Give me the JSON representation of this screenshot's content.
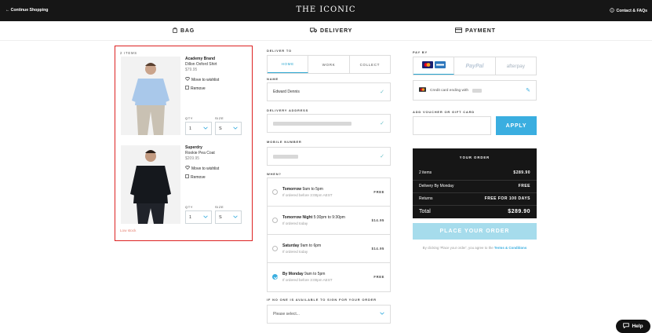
{
  "header": {
    "continue_label": "← Continue Shopping",
    "logo": "THE ICONIC",
    "contact_label": "Contact & FAQs"
  },
  "steps": [
    {
      "label": "BAG",
      "icon": "bag-icon"
    },
    {
      "label": "DELIVERY",
      "icon": "truck-icon"
    },
    {
      "label": "PAYMENT",
      "icon": "card-icon"
    }
  ],
  "bag": {
    "count_label": "2 ITEMS",
    "items": [
      {
        "brand": "Academy Brand",
        "name": "Dillon Oxford Shirt",
        "price": "$79.95",
        "wishlist": "Move to wishlist",
        "remove": "Remove",
        "qty_label": "QTY",
        "size_label": "SIZE",
        "qty": "1",
        "size": "S",
        "colors": {
          "garment": "#a9c8ea",
          "pants": "#c9c1b3"
        }
      },
      {
        "brand": "Superdry",
        "name": "Rookie Pea Coat",
        "price": "$209.95",
        "wishlist": "Move to wishlist",
        "remove": "Remove",
        "qty_label": "QTY",
        "size_label": "SIZE",
        "qty": "1",
        "size": "S",
        "colors": {
          "garment": "#15181d",
          "pants": "#20232a"
        }
      }
    ],
    "low_stock": "Low stock"
  },
  "delivery": {
    "deliver_to_label": "DELIVER TO",
    "tabs": [
      {
        "label": "HOME",
        "active": true
      },
      {
        "label": "WORK",
        "active": false
      },
      {
        "label": "COLLECT",
        "active": false
      }
    ],
    "name_label": "NAME",
    "name_value": "Edward Dennis",
    "address_label": "DELIVERY ADDRESS",
    "mobile_label": "MOBILE NUMBER",
    "when_label": "WHEN?",
    "slots": [
      {
        "day": "Tomorrow",
        "time": " 9am to 5pm",
        "note": "If ordered before 3:00pm AEST",
        "fee": "FREE",
        "selected": false
      },
      {
        "day": "Tomorrow Night",
        "time": " 5:30pm to 9:30pm",
        "note": "If ordered today",
        "fee": "$14.95",
        "selected": false
      },
      {
        "day": "Saturday",
        "time": " 9am to 6pm",
        "note": "If ordered today",
        "fee": "$14.95",
        "selected": false
      },
      {
        "day": "By Monday",
        "time": " 9am to 5pm",
        "note": "If ordered before 3:00pm AEST",
        "fee": "FREE",
        "selected": true
      }
    ],
    "sign_label": "IF NO ONE IS AVAILABLE TO SIGN FOR YOUR ORDER",
    "sign_placeholder": "Please select..."
  },
  "payment": {
    "pay_by_label": "PAY BY",
    "paypal": "PayPal",
    "afterpay": "afterpay",
    "card_text": "Credit card ending with",
    "voucher_label": "ADD VOUCHER OR GIFT CARD",
    "apply_label": "APPLY",
    "order": {
      "title": "YOUR ORDER",
      "rows": [
        {
          "label": "2 items",
          "value": "$289.90"
        },
        {
          "label": "Delivery By Monday",
          "value": "FREE"
        },
        {
          "label": "Returns",
          "value": "FREE FOR 100 DAYS"
        }
      ],
      "total_label": "Total",
      "total_value": "$289.90"
    },
    "place_label": "PLACE YOUR ORDER",
    "terms_prefix": "By clicking 'Place your order', you agree to the ",
    "terms_link": "Terms & Conditions",
    "accent": "#3aaee0"
  },
  "help_label": "Help"
}
